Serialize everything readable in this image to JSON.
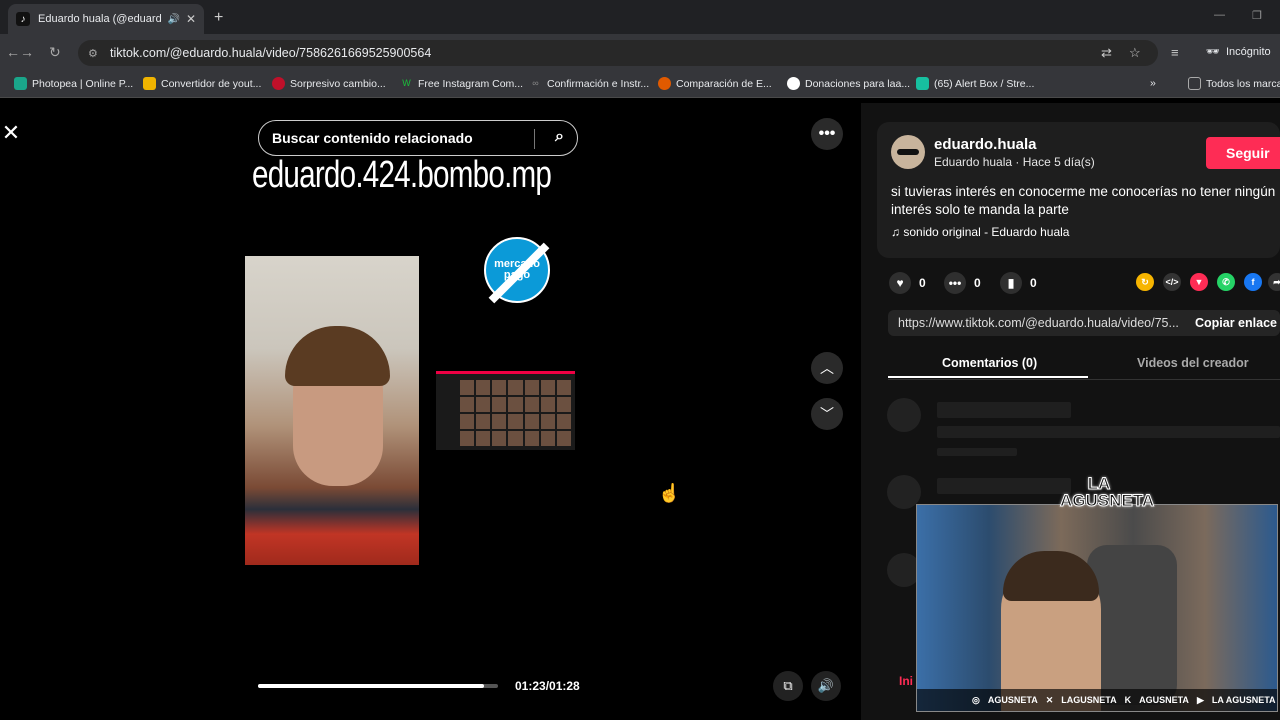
{
  "browser": {
    "tab_title": "Eduardo huala (@eduardo.h",
    "tab_favicon": "tiktok-icon",
    "url": "tiktok.com/@eduardo.huala/video/7586261669525900564",
    "incognito_label": "Incógnito",
    "bookmarks": [
      {
        "label": "Photopea | Online P...",
        "color": "#1aa68a"
      },
      {
        "label": "Convertidor de yout...",
        "color": "#f0b400"
      },
      {
        "label": "Sorpresivo cambio...",
        "color": "#c0102a"
      },
      {
        "label": "Free Instagram Com...",
        "color": "#1bbf3a"
      },
      {
        "label": "Confirmación e Instr...",
        "color": "#888888"
      },
      {
        "label": "Comparación de E...",
        "color": "#e05a00"
      },
      {
        "label": "Donaciones para laa...",
        "color": "#ffffff"
      },
      {
        "label": "(65) Alert Box / Stre...",
        "color": "#17c0a0"
      }
    ],
    "all_bookmarks_label": "Todos los marca"
  },
  "video": {
    "search_placeholder": "Buscar contenido relacionado",
    "overlay_title": "eduardo.424.bombo.mp",
    "logo_text": "mercado pago",
    "progress": 0.94,
    "time": "01:23/01:28"
  },
  "author": {
    "username": "eduardo.huala",
    "subline": "Eduardo huala · Hace 5 día(s)",
    "follow_label": "Seguir",
    "description_line1": "si tuvieras interés en conocerme me conocerías no tener ningún",
    "description_line2": "interés solo te manda la parte",
    "music": "sonido original - Eduardo huala",
    "likes": "0",
    "comments": "0",
    "saves": "0",
    "share_link": "https://www.tiktok.com/@eduardo.huala/video/75...",
    "copy_label": "Copiar enlace"
  },
  "tabs": {
    "comments": "Comentarios (0)",
    "creator_videos": "Videos del creador"
  },
  "stream_overlay": {
    "badge": "LA AGUSNETA",
    "socials": [
      "AGUSNETA",
      "LAGUSNETA",
      "AGUSNETA",
      "LA AGUSNETA"
    ]
  },
  "colors": {
    "accent": "#fe2c55",
    "background": "#000000",
    "panel": "#121212"
  }
}
